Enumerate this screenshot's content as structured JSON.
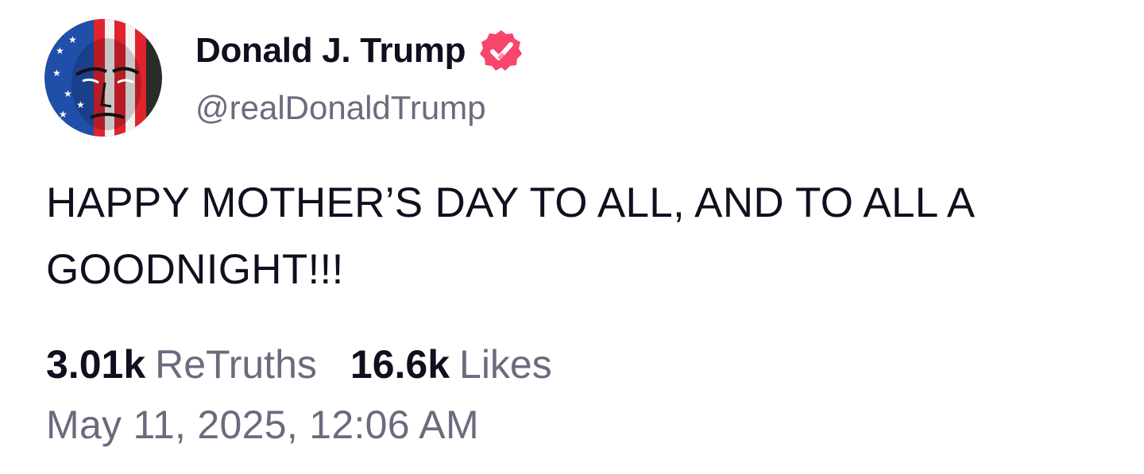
{
  "author": {
    "display_name": "Donald J. Trump",
    "handle": "@realDonaldTrump",
    "verified": true,
    "verified_icon": "verified-badge-icon",
    "verified_color": "#f7466c",
    "avatar": "profile-avatar"
  },
  "post": {
    "text": "HAPPY MOTHER’S DAY TO ALL, AND TO ALL A GOODNIGHT!!!",
    "timestamp": "May 11, 2025, 12:06 AM"
  },
  "stats": {
    "retruths_count": "3.01k",
    "retruths_label": "ReTruths",
    "likes_count": "16.6k",
    "likes_label": "Likes"
  },
  "colors": {
    "text_primary": "#0f0f1f",
    "text_secondary": "#6b6b7f",
    "background": "#ffffff"
  }
}
